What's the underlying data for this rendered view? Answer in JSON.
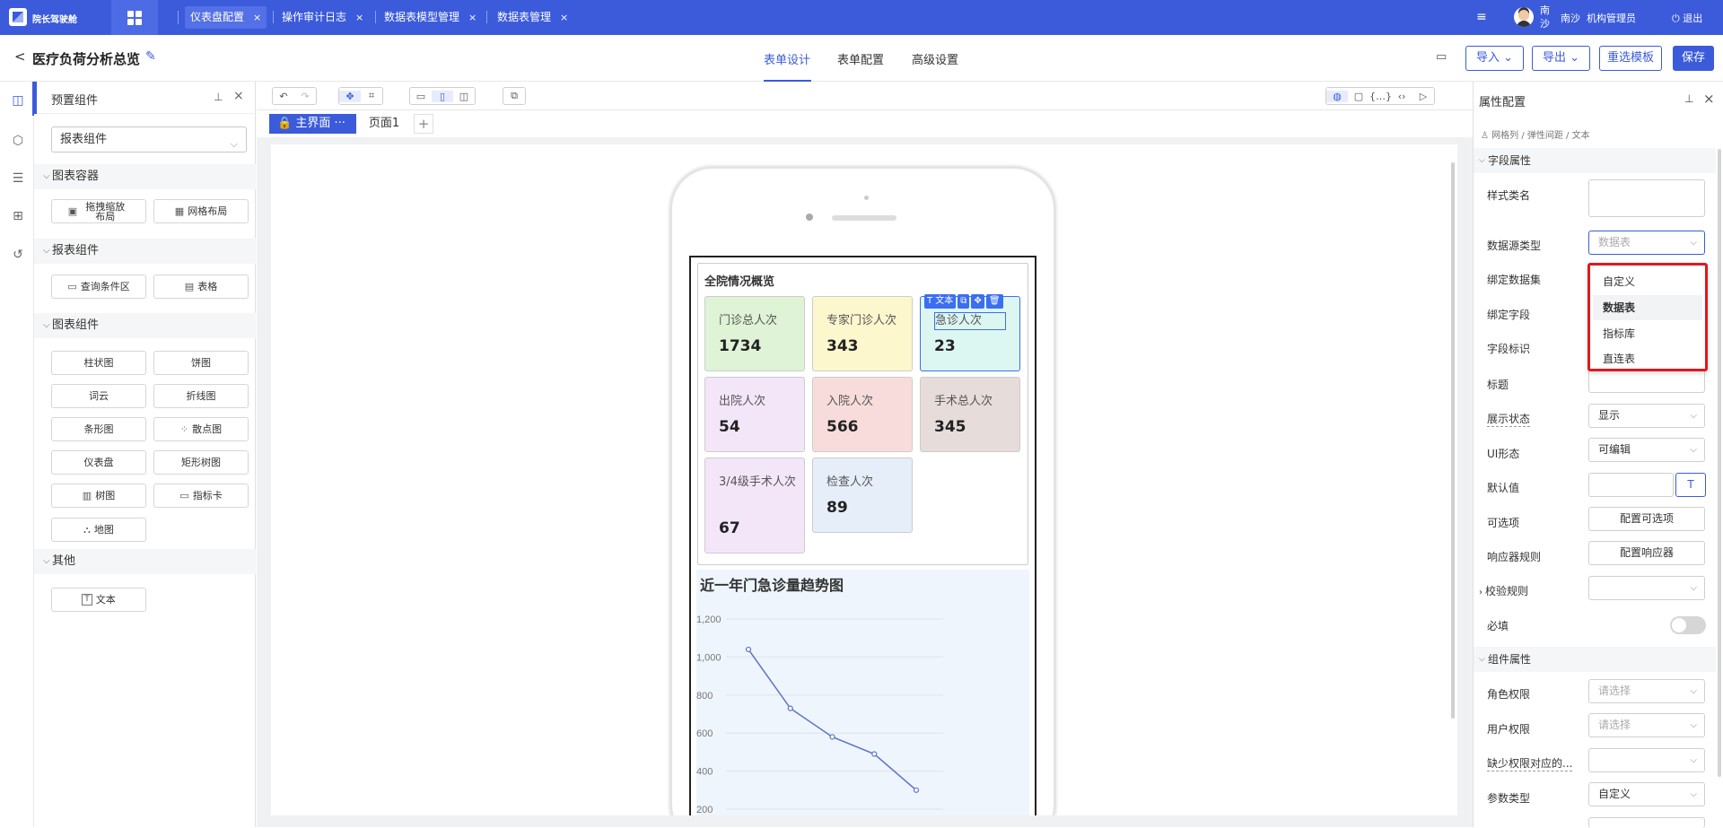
{
  "topbar": {
    "brand": "院长驾驶舱",
    "tabs": [
      {
        "label": "仪表盘配置",
        "close": "×"
      },
      {
        "label": "操作审计日志",
        "close": "×"
      },
      {
        "label": "数据表模型管理",
        "close": "×"
      },
      {
        "label": "数据表管理",
        "close": "×"
      }
    ],
    "menu_icon": "≡",
    "user_name": "南沙",
    "city": "南沙",
    "role": "机构管理员",
    "logout": "⏻ 退出"
  },
  "header": {
    "back": "<",
    "title": "医疗负荷分析总览",
    "edit_icon": "✎",
    "center_tabs": [
      "表单设计",
      "表单配置",
      "高级设置"
    ],
    "import_label": "导入 ⌄",
    "export_label": "导出 ⌄",
    "reselect_label": "重选模板",
    "save_label": "保存",
    "msg_icon": "▭"
  },
  "iconbar": {
    "icons": [
      "◫",
      "⬡",
      "☰",
      "⊞",
      "↺"
    ]
  },
  "left_panel": {
    "title": "预置组件",
    "pin": "⊥",
    "close": "×",
    "select_value": "报表组件",
    "groups": [
      {
        "title": "图表容器",
        "items": [
          {
            "icon": "▣",
            "label": "拖拽缩放布局"
          },
          {
            "icon": "▦",
            "label": "网格布局"
          }
        ]
      },
      {
        "title": "报表组件",
        "items": [
          {
            "icon": "▭",
            "label": "查询条件区"
          },
          {
            "icon": "▤",
            "label": "表格"
          }
        ]
      },
      {
        "title": "图表组件",
        "items": [
          {
            "icon": "",
            "label": "柱状图"
          },
          {
            "icon": "",
            "label": "饼图"
          },
          {
            "icon": "",
            "label": "词云"
          },
          {
            "icon": "",
            "label": "折线图"
          },
          {
            "icon": "",
            "label": "条形图"
          },
          {
            "icon": "⁘",
            "label": "散点图"
          },
          {
            "icon": "",
            "label": "仪表盘"
          },
          {
            "icon": "",
            "label": "矩形树图"
          },
          {
            "icon": "▥",
            "label": "树图"
          },
          {
            "icon": "▭",
            "label": "指标卡"
          },
          {
            "icon": "⛬",
            "label": "地图"
          }
        ]
      },
      {
        "title": "其他",
        "items": [
          {
            "icon": "T",
            "label": "文本"
          }
        ]
      }
    ]
  },
  "toolbar": {
    "undo": "↶",
    "redo": "↷",
    "move": "✥",
    "frame": "⌗",
    "desktop": "▭",
    "phone": "▯",
    "tablet": "◫",
    "copy": "⧉",
    "right": [
      "◍",
      "▢",
      "{…}",
      "‹›",
      "▷"
    ]
  },
  "pages": {
    "main": "🔒 主界面 ···",
    "page1": "页面1",
    "add": "+"
  },
  "overview": {
    "title": "全院情况概览",
    "cards": [
      {
        "label": "门诊总人次",
        "value": "1734",
        "color": "#dff3d6"
      },
      {
        "label": "专家门诊人次",
        "value": "343",
        "color": "#fdf7cd"
      },
      {
        "label": "急诊人次",
        "value": "23",
        "color": "#dcf6f2"
      },
      {
        "label": "出院人次",
        "value": "54",
        "color": "#f4e6f9"
      },
      {
        "label": "入院人次",
        "value": "566",
        "color": "#f8dcdc"
      },
      {
        "label": "手术总人次",
        "value": "345",
        "color": "#e6dcda"
      },
      {
        "label": "3/4级手术人次",
        "value": "67",
        "color": "#f4e6f9"
      },
      {
        "label": "检查人次",
        "value": "89",
        "color": "#e6eef9"
      }
    ],
    "toolbar": [
      "T 文本",
      "⧉",
      "✥",
      "🗑"
    ]
  },
  "chart_data": {
    "type": "line",
    "title": "近一年门急诊量趋势图",
    "xlabel": "",
    "ylabel": "",
    "y_ticks": [
      "1,200",
      "1,000",
      "800",
      "600",
      "400",
      "200"
    ],
    "ylim": [
      200,
      1200
    ],
    "x": [
      1,
      2,
      3,
      4,
      5
    ],
    "series": [
      {
        "values": [
          1040,
          730,
          580,
          490,
          300
        ]
      }
    ],
    "line_color": "#5b73c9",
    "grid": true
  },
  "right_panel": {
    "title": "属性配置",
    "pin": "⊥",
    "close": "×",
    "breadcrumb": "♙ 网格列 / 弹性间距 / 文本",
    "field_group": "字段属性",
    "component_group": "组件属性",
    "rows": {
      "style_class": "样式类名",
      "datasource_type": "数据源类型",
      "datasource_value": "数据表",
      "bind_dataset": "绑定数据集",
      "bind_field": "绑定字段",
      "field_id": "字段标识",
      "title": "标题",
      "display_state": "展示状态",
      "display_value": "显示",
      "ui_form": "UI形态",
      "ui_value": "可编辑",
      "default": "默认值",
      "default_btn": "T",
      "options": "可选项",
      "options_btn": "配置可选项",
      "responder": "响应器规则",
      "responder_btn": "配置响应器",
      "validation": "校验规则",
      "required": "必填",
      "role_perm": "角色权限",
      "role_value": "请选择",
      "user_perm": "用户权限",
      "user_value": "请选择",
      "missing_perm": "缺少权限对应的...",
      "param_type": "参数类型",
      "param_value": "自定义"
    },
    "dropdown": [
      "自定义",
      "数据表",
      "指标库",
      "直连表"
    ]
  }
}
